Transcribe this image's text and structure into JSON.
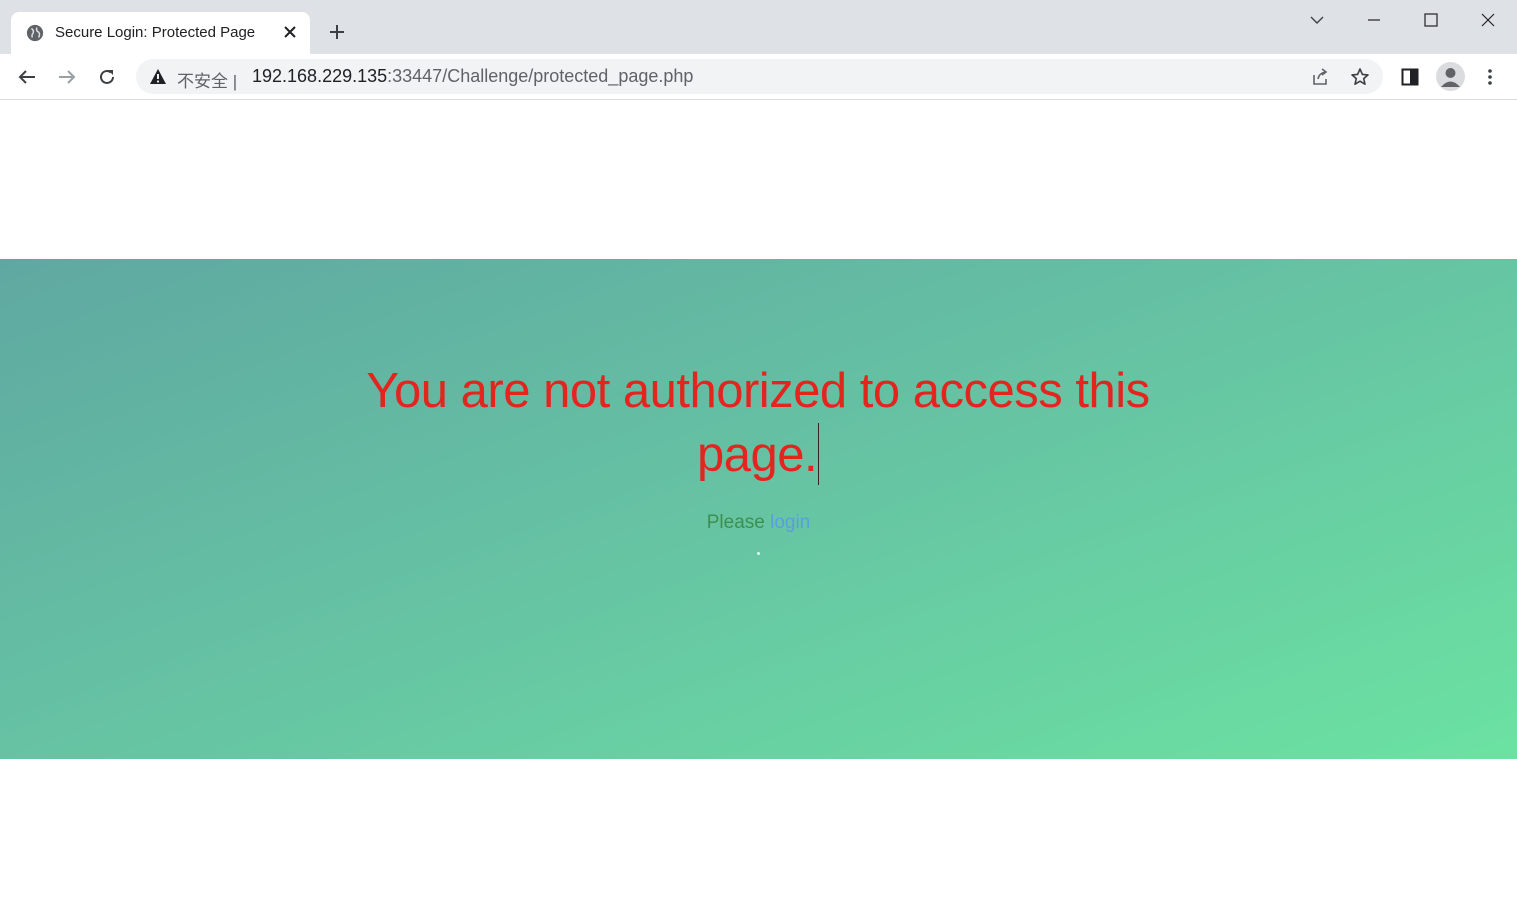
{
  "browser": {
    "tab": {
      "title": "Secure Login: Protected Page",
      "favicon": "globe-icon"
    },
    "new_tab_icon": "plus-icon",
    "window_controls": [
      "chevron-down-icon",
      "minimize-icon",
      "maximize-icon",
      "close-icon"
    ],
    "address_bar": {
      "security_label": "不安全 |",
      "url_host": "192.168.229.135",
      "url_rest": ":33447/Challenge/protected_page.php"
    }
  },
  "page": {
    "headline": "You are not authorized to access this page.",
    "prompt_text": "Please ",
    "login_link": "login",
    "colors": {
      "headline": "#e4251f",
      "prompt": "#3c8f4f",
      "link": "#5b9ee0",
      "gradient_start": "#5fa8a2",
      "gradient_end": "#6be2a2"
    }
  }
}
